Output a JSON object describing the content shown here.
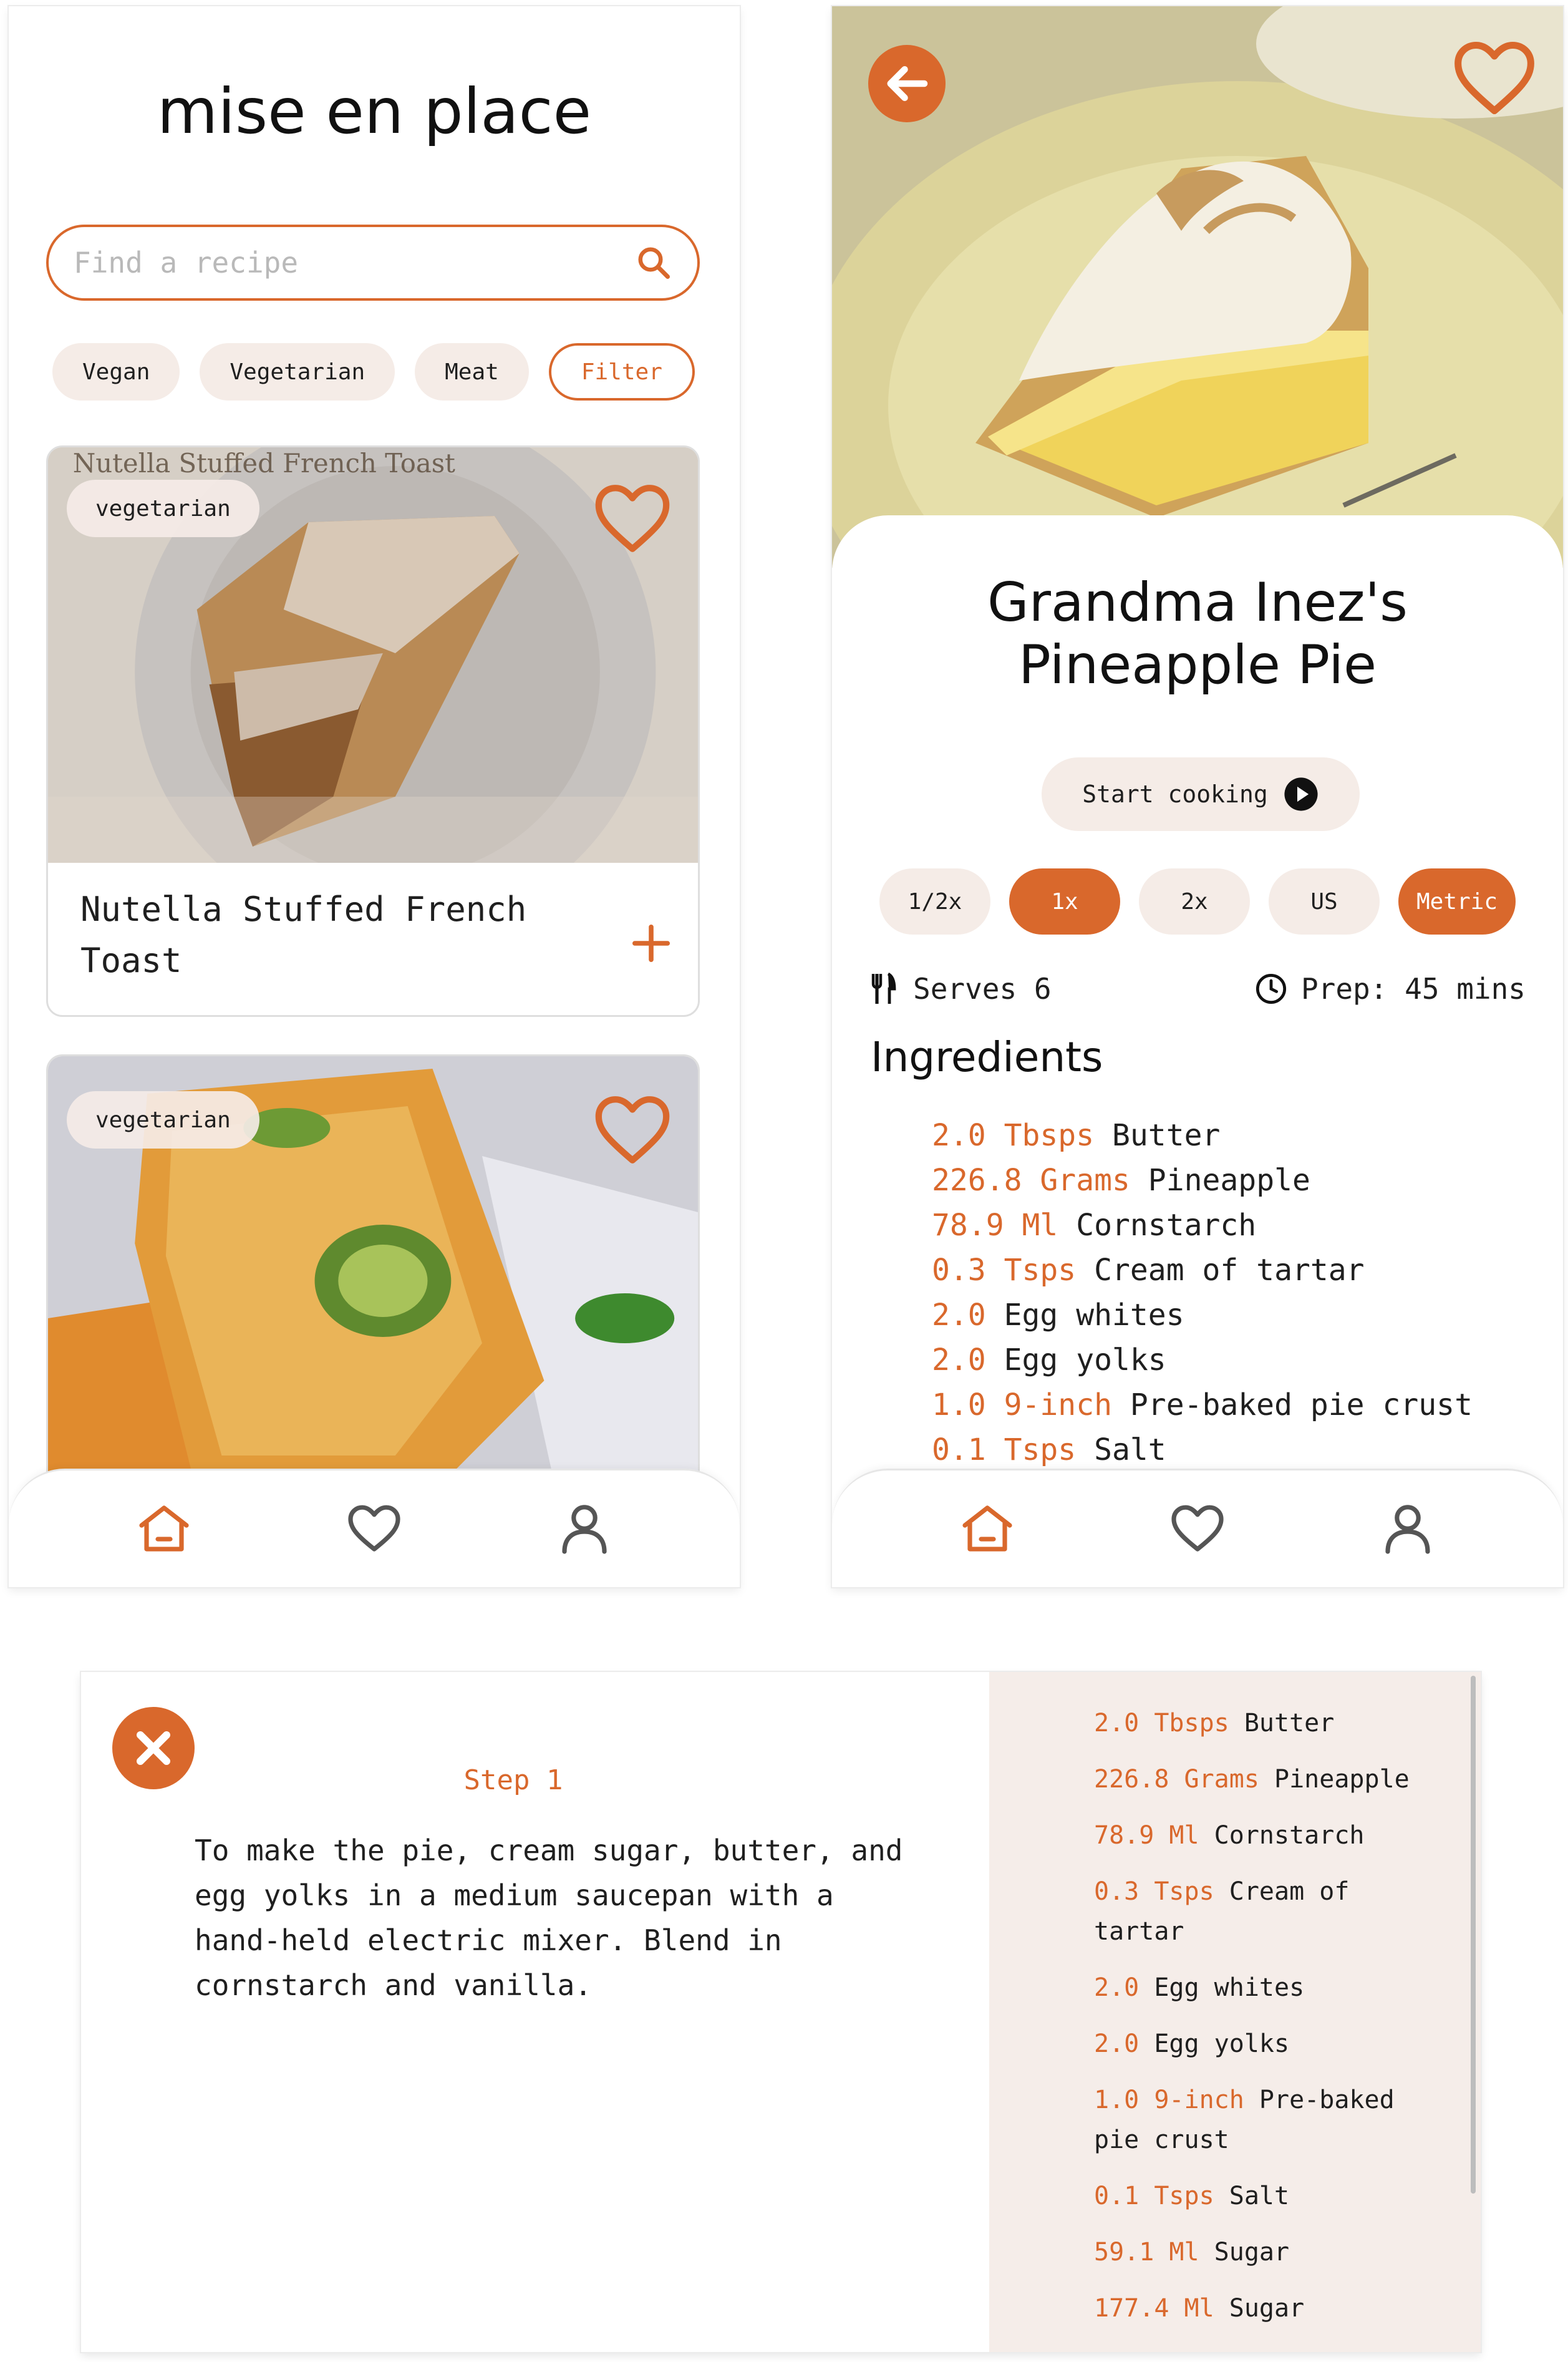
{
  "colors": {
    "accent": "#d9682c",
    "chip_bg": "#f5ece7",
    "panel_bg": "#f5ede9"
  },
  "home": {
    "app_title": "mise en place",
    "search": {
      "placeholder": "Find a recipe",
      "value": ""
    },
    "chips": [
      "Vegan",
      "Vegetarian",
      "Meat"
    ],
    "filter_label": "Filter",
    "cards": [
      {
        "title": "Nutella Stuffed French Toast",
        "tag": "vegetarian",
        "photo_caption": "Nutella Stuffed French Toast"
      },
      {
        "title": "",
        "tag": "vegetarian"
      }
    ]
  },
  "detail": {
    "title_line1": "Grandma Inez's",
    "title_line2": "Pineapple Pie",
    "start_label": "Start cooking",
    "scales": [
      "1/2x",
      "1x",
      "2x"
    ],
    "units": [
      "US",
      "Metric"
    ],
    "selected_scale": "1x",
    "selected_unit": "Metric",
    "serves": "Serves 6",
    "prep": "Prep: 45 mins",
    "ingredients_heading": "Ingredients",
    "ingredients": [
      {
        "amount": "2.0 Tbsps",
        "item": "Butter"
      },
      {
        "amount": "226.8 Grams",
        "item": "Pineapple"
      },
      {
        "amount": "78.9 Ml",
        "item": "Cornstarch"
      },
      {
        "amount": "0.3 Tsps",
        "item": "Cream of tartar"
      },
      {
        "amount": "2.0",
        "item": "Egg whites"
      },
      {
        "amount": "2.0",
        "item": "Egg yolks"
      },
      {
        "amount": "1.0 9-inch",
        "item": "Pre-baked pie crust"
      },
      {
        "amount": "0.1 Tsps",
        "item": "Salt"
      }
    ]
  },
  "step": {
    "label": "Step 1",
    "text": "To make the pie, cream sugar, butter, and egg yolks in a medium saucepan with a hand-held electric mixer. Blend in cornstarch and vanilla.",
    "side_ingredients": [
      {
        "amount": "2.0 Tbsps",
        "item": "Butter"
      },
      {
        "amount": "226.8 Grams",
        "item": "Pineapple"
      },
      {
        "amount": "78.9 Ml",
        "item": "Cornstarch"
      },
      {
        "amount": "0.3 Tsps",
        "item": "Cream of tartar"
      },
      {
        "amount": "2.0",
        "item": "Egg whites"
      },
      {
        "amount": "2.0",
        "item": "Egg yolks"
      },
      {
        "amount": "1.0 9-inch",
        "item": "Pre-baked pie crust"
      },
      {
        "amount": "0.1 Tsps",
        "item": "Salt"
      },
      {
        "amount": "59.1 Ml",
        "item": "Sugar"
      },
      {
        "amount": "177.4 Ml",
        "item": "Sugar"
      }
    ]
  },
  "nav": {
    "items": [
      "home-icon",
      "heart-icon",
      "user-icon"
    ],
    "active": "home-icon"
  }
}
